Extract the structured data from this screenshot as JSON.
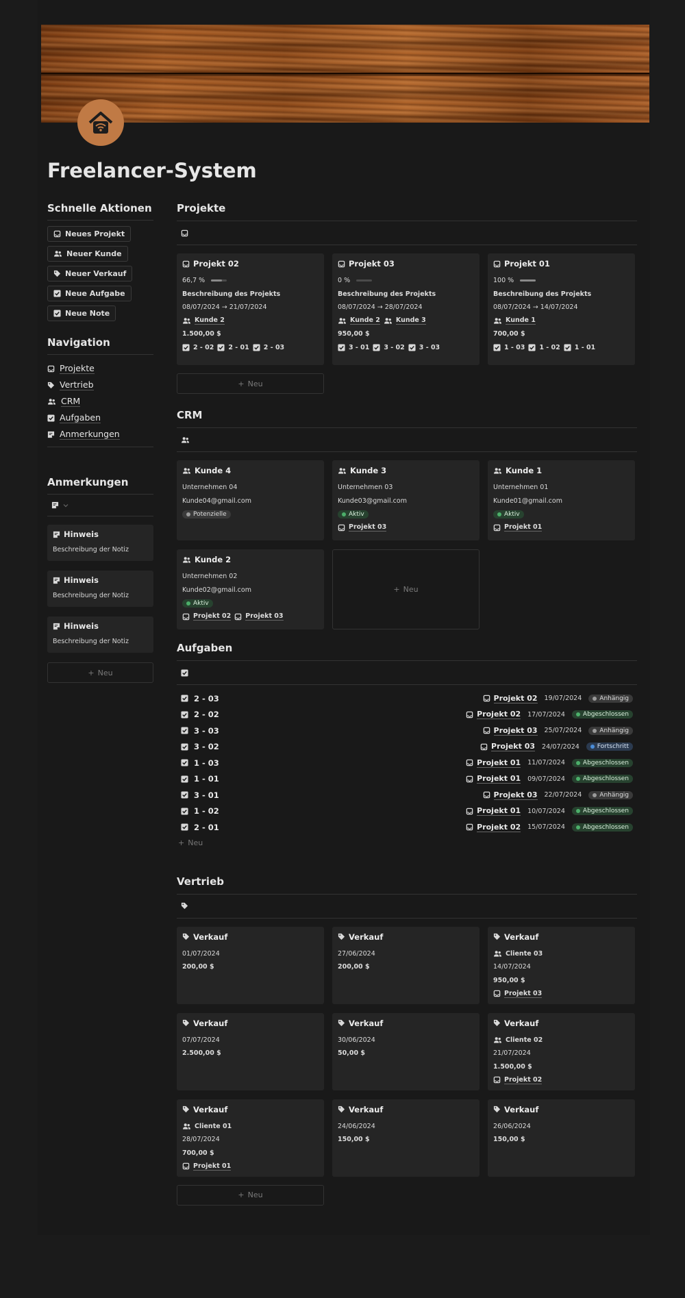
{
  "page": {
    "title": "Freelancer-System"
  },
  "quick_actions": {
    "title": "Schnelle Aktionen",
    "buttons": [
      {
        "label": "Neues Projekt",
        "icon": "inbox-icon"
      },
      {
        "label": "Neuer Kunde",
        "icon": "users-icon"
      },
      {
        "label": "Neuer Verkauf",
        "icon": "tag-icon"
      },
      {
        "label": "Neue Aufgabe",
        "icon": "checkbox-icon"
      },
      {
        "label": "Neue Note",
        "icon": "checkbox-icon"
      }
    ]
  },
  "navigation": {
    "title": "Navigation",
    "items": [
      {
        "label": "Projekte",
        "icon": "inbox-icon"
      },
      {
        "label": "Vertrieb",
        "icon": "tag-icon"
      },
      {
        "label": "CRM",
        "icon": "users-icon"
      },
      {
        "label": "Aufgaben",
        "icon": "checkbox-icon"
      },
      {
        "label": "Anmerkungen",
        "icon": "note-icon"
      }
    ]
  },
  "notes": {
    "title": "Anmerkungen",
    "items": [
      {
        "title": "Hinweis",
        "desc": "Beschreibung der Notiz"
      },
      {
        "title": "Hinweis",
        "desc": "Beschreibung der Notiz"
      },
      {
        "title": "Hinweis",
        "desc": "Beschreibung der Notiz"
      }
    ],
    "new_label": "Neu"
  },
  "projects": {
    "title": "Projekte",
    "new_label": "Neu",
    "items": [
      {
        "name": "Projekt 02",
        "progress": "66,7 %",
        "progress_value": 0.667,
        "desc": "Beschreibung des Projekts",
        "dates": "08/07/2024 → 21/07/2024",
        "clients": [
          "Kunde 2"
        ],
        "amount": "1.500,00 $",
        "tasks": [
          "2 - 02",
          "2 - 01",
          "2 - 03"
        ]
      },
      {
        "name": "Projekt 03",
        "progress": "0 %",
        "progress_value": 0,
        "desc": "Beschreibung des Projekts",
        "dates": "08/07/2024 → 28/07/2024",
        "clients": [
          "Kunde 2",
          "Kunde 3"
        ],
        "amount": "950,00 $",
        "tasks": [
          "3 - 01",
          "3 - 02",
          "3 - 03"
        ]
      },
      {
        "name": "Projekt 01",
        "progress": "100 %",
        "progress_value": 1,
        "desc": "Beschreibung des Projekts",
        "dates": "08/07/2024 → 14/07/2024",
        "clients": [
          "Kunde 1"
        ],
        "amount": "700,00 $",
        "tasks": [
          "1 - 03",
          "1 - 02",
          "1 - 01"
        ]
      }
    ]
  },
  "crm": {
    "title": "CRM",
    "new_label": "Neu",
    "items": [
      {
        "name": "Kunde 4",
        "company": "Unternehmen 04",
        "email": "Kunde04@gmail.com",
        "status": "Potenzielle",
        "status_color": "gray",
        "projects": []
      },
      {
        "name": "Kunde 3",
        "company": "Unternehmen 03",
        "email": "Kunde03@gmail.com",
        "status": "Aktiv",
        "status_color": "green",
        "projects": [
          "Projekt 03"
        ]
      },
      {
        "name": "Kunde 1",
        "company": "Unternehmen 01",
        "email": "Kunde01@gmail.com",
        "status": "Aktiv",
        "status_color": "green",
        "projects": [
          "Projekt 01"
        ]
      },
      {
        "name": "Kunde 2",
        "company": "Unternehmen 02",
        "email": "Kunde02@gmail.com",
        "status": "Aktiv",
        "status_color": "green",
        "projects": [
          "Projekt 02",
          "Projekt 03"
        ]
      }
    ]
  },
  "tasks": {
    "title": "Aufgaben",
    "new_label": "Neu",
    "items": [
      {
        "name": "2 - 03",
        "project": "Projekt 02",
        "date": "19/07/2024",
        "status": "Anhängig",
        "status_color": "gray"
      },
      {
        "name": "2 - 02",
        "project": "Projekt 02",
        "date": "17/07/2024",
        "status": "Abgeschlossen",
        "status_color": "green"
      },
      {
        "name": "3 - 03",
        "project": "Projekt 03",
        "date": "25/07/2024",
        "status": "Anhängig",
        "status_color": "gray"
      },
      {
        "name": "3 - 02",
        "project": "Projekt 03",
        "date": "24/07/2024",
        "status": "Fortschritt",
        "status_color": "blue"
      },
      {
        "name": "1 - 03",
        "project": "Projekt 01",
        "date": "11/07/2024",
        "status": "Abgeschlossen",
        "status_color": "green"
      },
      {
        "name": "1 - 01",
        "project": "Projekt 01",
        "date": "09/07/2024",
        "status": "Abgeschlossen",
        "status_color": "green"
      },
      {
        "name": "3 - 01",
        "project": "Projekt 03",
        "date": "22/07/2024",
        "status": "Anhängig",
        "status_color": "gray"
      },
      {
        "name": "1 - 02",
        "project": "Projekt 01",
        "date": "10/07/2024",
        "status": "Abgeschlossen",
        "status_color": "green"
      },
      {
        "name": "2 - 01",
        "project": "Projekt 02",
        "date": "15/07/2024",
        "status": "Abgeschlossen",
        "status_color": "green"
      }
    ]
  },
  "sales": {
    "title": "Vertrieb",
    "new_label": "Neu",
    "items": [
      {
        "name": "Verkauf",
        "client": "",
        "date": "01/07/2024",
        "amount": "200,00 $",
        "project": ""
      },
      {
        "name": "Verkauf",
        "client": "",
        "date": "27/06/2024",
        "amount": "200,00 $",
        "project": ""
      },
      {
        "name": "Verkauf",
        "client": "Cliente 03",
        "date": "14/07/2024",
        "amount": "950,00 $",
        "project": "Projekt 03"
      },
      {
        "name": "Verkauf",
        "client": "",
        "date": "07/07/2024",
        "amount": "2.500,00 $",
        "project": ""
      },
      {
        "name": "Verkauf",
        "client": "",
        "date": "30/06/2024",
        "amount": "50,00 $",
        "project": ""
      },
      {
        "name": "Verkauf",
        "client": "Cliente 02",
        "date": "21/07/2024",
        "amount": "1.500,00 $",
        "project": "Projekt 02"
      },
      {
        "name": "Verkauf",
        "client": "Cliente 01",
        "date": "28/07/2024",
        "amount": "700,00 $",
        "project": "Projekt 01"
      },
      {
        "name": "Verkauf",
        "client": "",
        "date": "24/06/2024",
        "amount": "150,00 $",
        "project": ""
      },
      {
        "name": "Verkauf",
        "client": "",
        "date": "26/06/2024",
        "amount": "150,00 $",
        "project": ""
      }
    ]
  }
}
